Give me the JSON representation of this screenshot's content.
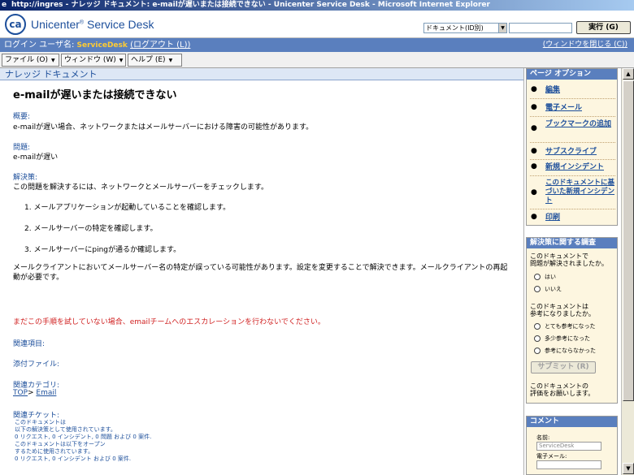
{
  "window": {
    "title": "http://ingres - ナレッジ ドキュメント: e-mailが遅いまたは接続できない - Unicenter Service Desk - Microsoft Internet Explorer"
  },
  "header": {
    "logo_text": "ca",
    "app_name": "Unicenter",
    "app_name_tail": " Service Desk",
    "reg_mark": "®",
    "search_type": "ドキュメント(ID別)",
    "run_label": "実行 (G)"
  },
  "loginbar": {
    "login_label": "ログイン ユーザ名: ",
    "username": "ServiceDesk",
    "logout": "(ログアウト (L))",
    "close_window": "(ウィンドウを閉じる (C))"
  },
  "menu": {
    "file": "ファイル (O)",
    "window": "ウィンドウ (W)",
    "help": "ヘルプ (E)"
  },
  "doc": {
    "section_header": "ナレッジ ドキュメント",
    "title": "e-mailが遅いまたは接続できない",
    "summary_label": "概要:",
    "summary_text": "e-mailが遅い場合、ネットワークまたはメールサーバーにおける障害の可能性があります。",
    "problem_label": "問題:",
    "problem_text": "e-mailが遅い",
    "solution_label": "解決策:",
    "solution_text": "この問題を解決するには、ネットワークとメールサーバーをチェックします。",
    "step1": "1.  メールアプリケーションが起動していることを確認します。",
    "step2": "2. メールサーバーの特定を確認します。",
    "step3": "3. メールサーバーにpingが通るか確認します。",
    "note": "メールクライアントにおいてメールサーバー名の特定が誤っている可能性があります。設定を変更することで解決できます。メールクライアントの再起動が必要です。",
    "warning": "まだこの手順を試していない場合、emailチームへのエスカレーションを行わないでください。",
    "related_items": "関連項目:",
    "attachments": "添付ファイル:",
    "categories_label": "関連カテゴリ:",
    "cat_top": "TOP",
    "cat_sep": "> ",
    "cat_email": "Email",
    "tickets_label": "関連チケット:",
    "tickets_line1": "このドキュメントは",
    "tickets_line2": "以下の解決策として使用されています。",
    "tickets_line3": "0 リクエスト, 0 インシデント, 0 問題 および 0 案件.",
    "tickets_line4": "このドキュメントは以下をオープン",
    "tickets_line5": "するために使用されています。",
    "tickets_line6": "0 リクエスト, 0 インシデント および 0 案件."
  },
  "sidebar": {
    "page_options_header": "ページ オプション",
    "options": [
      "編集",
      "電子メール",
      "ブックマークの追加",
      "サブスクライブ",
      "新規インシデント",
      "このドキュメントに基づいた新規インシデント",
      "印刷"
    ],
    "survey_header": "解決策に関する調査",
    "survey_q1a": "このドキュメントで",
    "survey_q1b": "問題が解決されましたか。",
    "yes": "はい",
    "no": "いいえ",
    "survey_q2a": "このドキュメントは",
    "survey_q2b": "参考になりましたか。",
    "helpful1": "とても参考になった",
    "helpful2": "多少参考になった",
    "helpful3": "参考にならなかった",
    "submit": "サブミット (R)",
    "rate_a": "このドキュメントの",
    "rate_b": "評価をお願いします。",
    "comment_header": "コメント",
    "name_label": "名前:",
    "name_value": "ServiceDesk",
    "email_label": "電子メール:"
  }
}
